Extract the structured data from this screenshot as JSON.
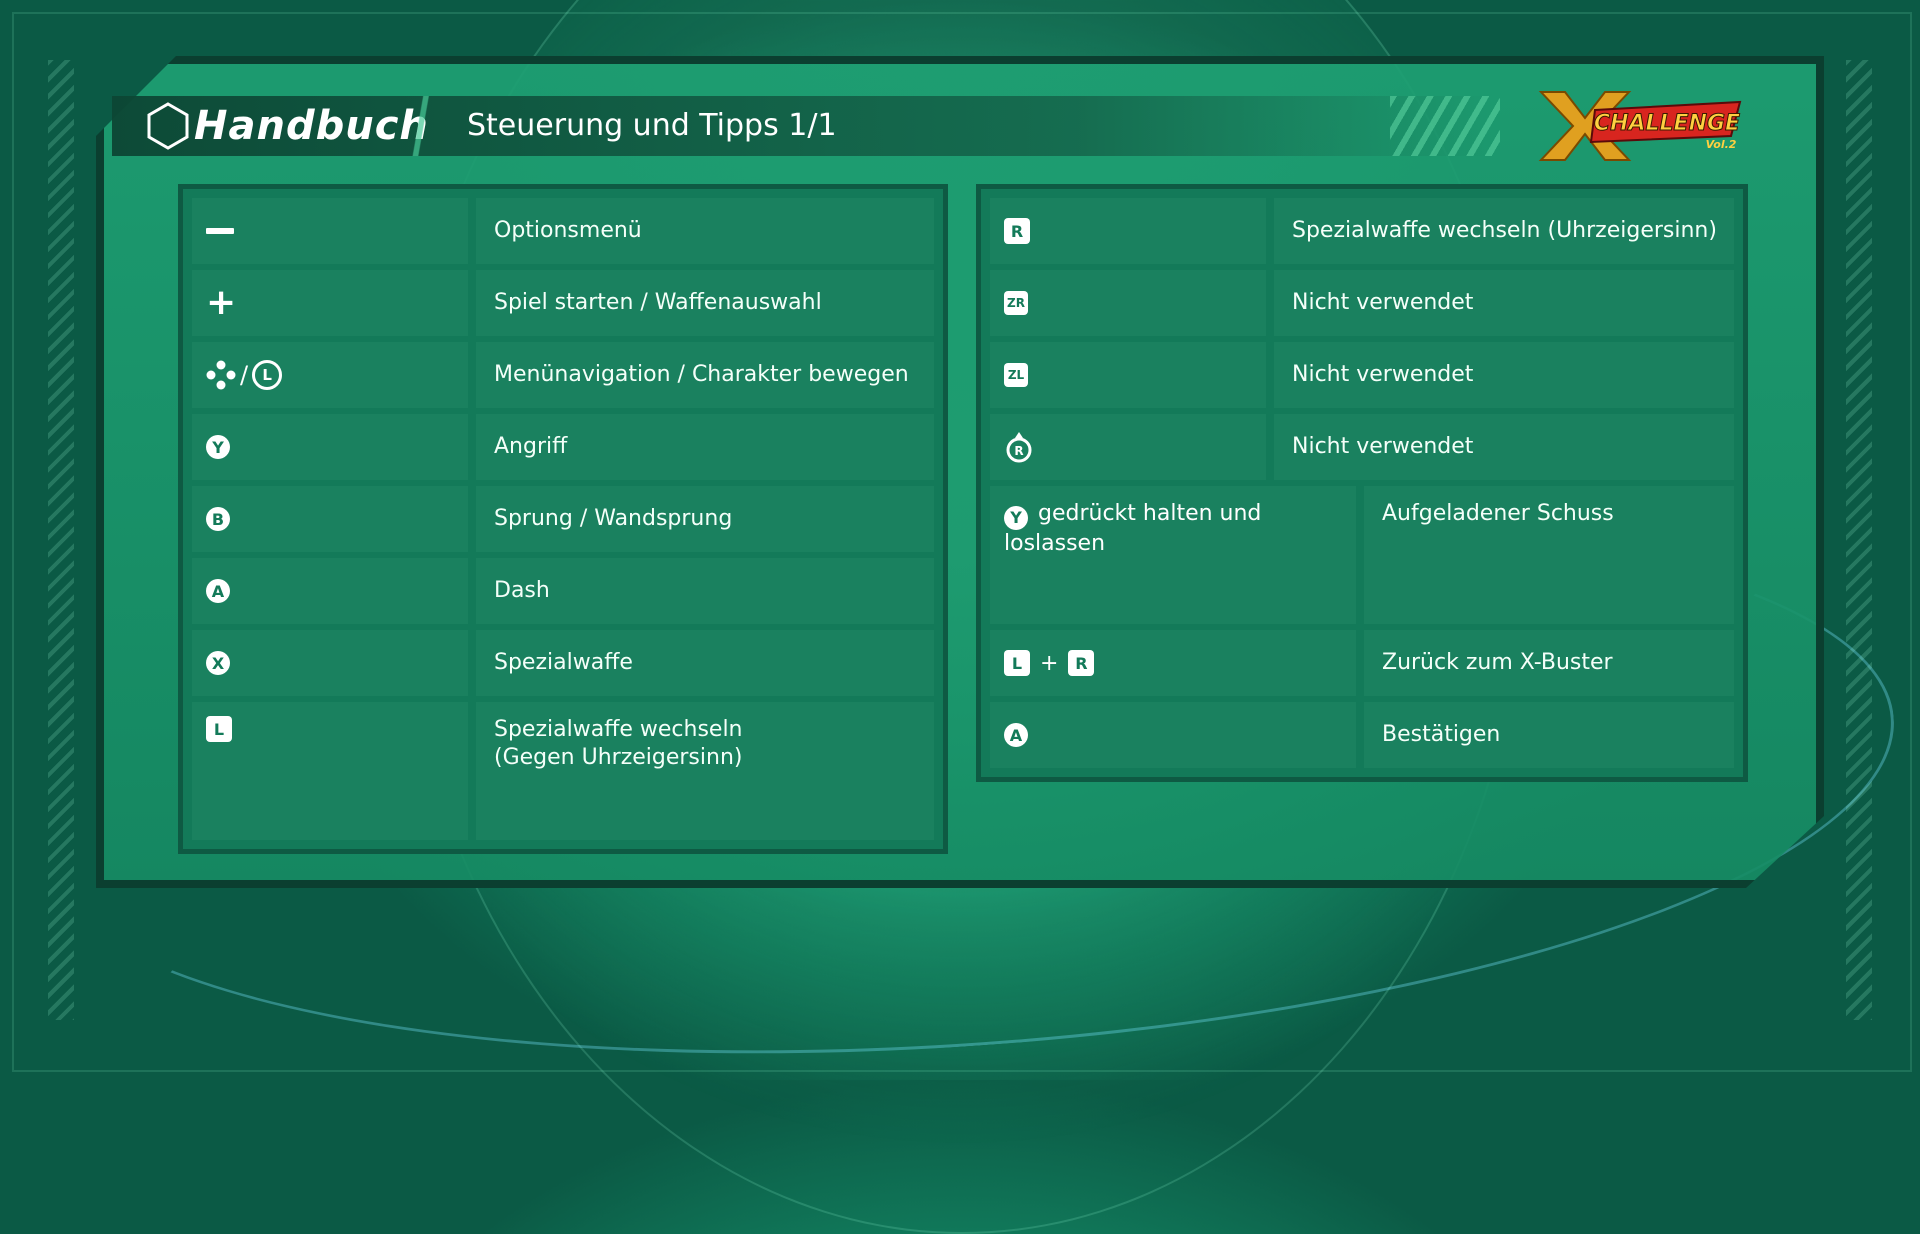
{
  "header": {
    "section": "Handbuch",
    "title": "Steuerung und Tipps 1/1",
    "logo_text": "X CHALLENGE",
    "logo_sub": "Vol.2"
  },
  "left_table": [
    {
      "button": "−",
      "icons": [
        "minus-button-icon"
      ],
      "action": "Optionsmenü"
    },
    {
      "button": "+",
      "icons": [
        "plus-button-icon"
      ],
      "action": "Spiel starten / Waffenauswahl"
    },
    {
      "button": "/",
      "icons": [
        "dpad-icon",
        "left-stick-icon"
      ],
      "stick_label": "L",
      "action": "Menünavigation / Charakter bewegen"
    },
    {
      "button": "Y",
      "icons": [
        "y-button-icon"
      ],
      "action": "Angriff"
    },
    {
      "button": "B",
      "icons": [
        "b-button-icon"
      ],
      "action": "Sprung / Wandsprung"
    },
    {
      "button": "A",
      "icons": [
        "a-button-icon"
      ],
      "action": "Dash"
    },
    {
      "button": "X",
      "icons": [
        "x-button-icon"
      ],
      "action": "Spezialwaffe"
    },
    {
      "button": "L",
      "icons": [
        "l-button-icon"
      ],
      "action": "Spezialwaffe wechseln\n(Gegen Uhrzeigersinn)"
    }
  ],
  "right_table": [
    {
      "button": "R",
      "icons": [
        "r-button-icon"
      ],
      "action": "Spezialwaffe wechseln (Uhrzeigersinn)"
    },
    {
      "button": "ZR",
      "icons": [
        "zr-button-icon"
      ],
      "action": "Nicht verwendet"
    },
    {
      "button": "ZL",
      "icons": [
        "zl-button-icon"
      ],
      "action": "Nicht verwendet"
    },
    {
      "button": "R",
      "icons": [
        "right-stick-press-icon"
      ],
      "action": "Nicht verwendet"
    },
    {
      "button": "Y",
      "icons": [
        "y-button-icon"
      ],
      "hold_text": "gedrückt halten und loslassen",
      "action": "Aufgeladener Schuss"
    },
    {
      "button": "L",
      "button2": "R",
      "plus": "+",
      "icons": [
        "l-button-icon",
        "r-button-icon"
      ],
      "action": "Zurück zum X-Buster"
    },
    {
      "button": "A",
      "icons": [
        "a-button-icon"
      ],
      "action": "Bestätigen"
    }
  ],
  "colors": {
    "background": "#1fae7e",
    "panel": "#1ea073",
    "table_border": "#0e5a43",
    "cell": "#1a8260",
    "text": "#f4fff9"
  }
}
